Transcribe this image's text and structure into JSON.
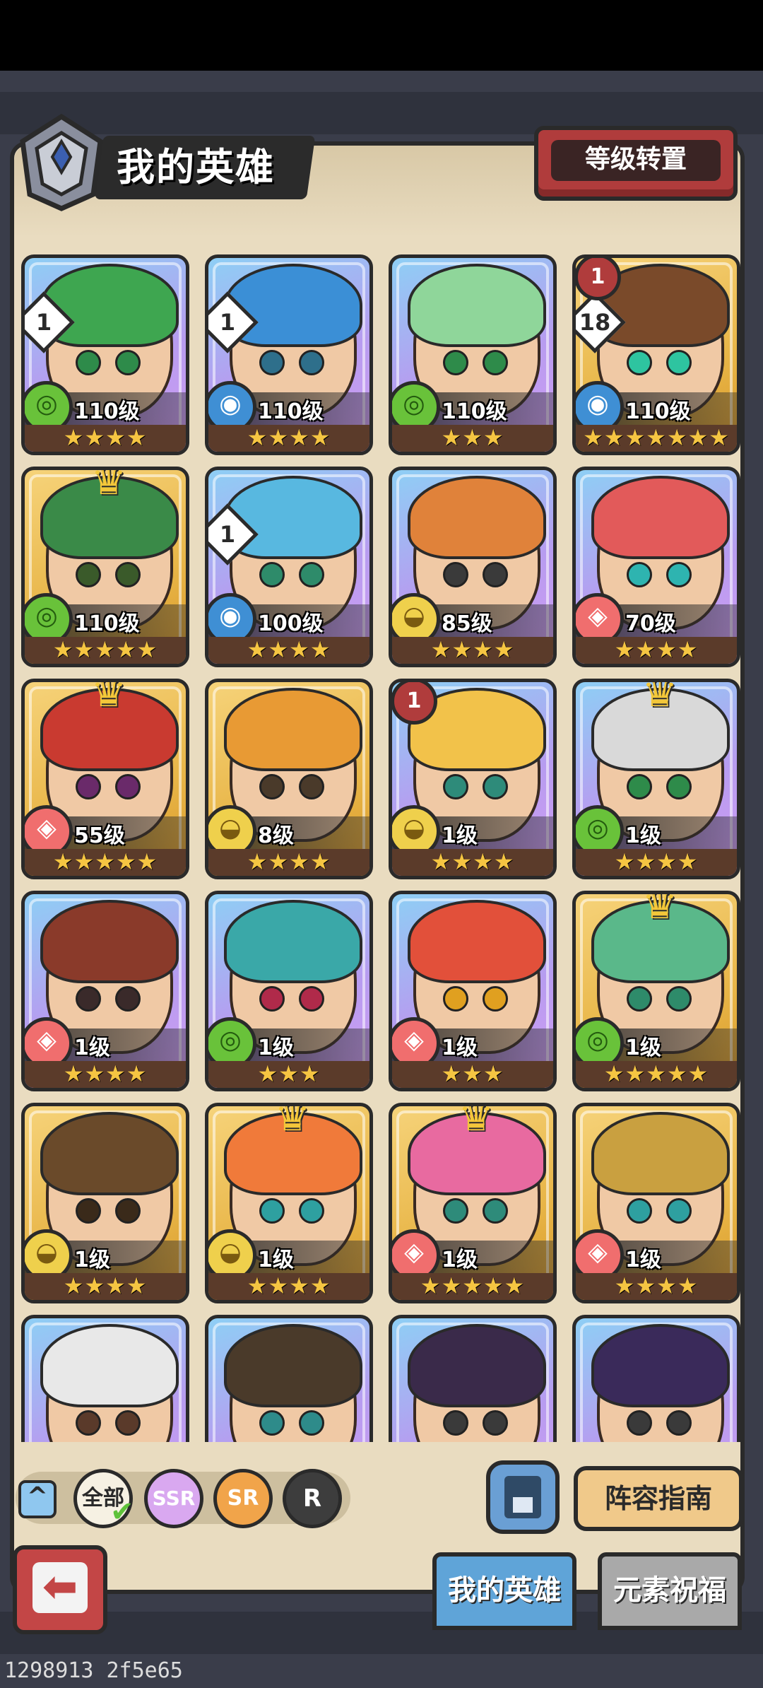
{
  "header": {
    "title": "我的英雄",
    "transfer_button": "等级转置"
  },
  "heroes": [
    {
      "rarity": "ssr",
      "element": "wind",
      "level": "110级",
      "stars": "★★★★",
      "badge": "1",
      "crown": false,
      "rank": "",
      "hair": "#3ea650",
      "eye": "#2e8b4a"
    },
    {
      "rarity": "ssr",
      "element": "water",
      "level": "110级",
      "stars": "★★★★",
      "badge": "1",
      "crown": false,
      "rank": "",
      "hair": "#3b8fd6",
      "eye": "#2e6f8b"
    },
    {
      "rarity": "ssr",
      "element": "wind",
      "level": "110级",
      "stars": "★★★",
      "badge": "",
      "crown": false,
      "rank": "",
      "hair": "#8fd69a",
      "eye": "#2e8b4a"
    },
    {
      "rarity": "sr",
      "element": "water",
      "level": "110级",
      "stars": "★★★★★★★",
      "badge": "18",
      "crown": false,
      "rank": "1",
      "hair": "#7a4a2a",
      "eye": "#2ec4a0"
    },
    {
      "rarity": "sr",
      "element": "wind",
      "level": "110级",
      "stars": "★★★★★",
      "badge": "",
      "crown": true,
      "rank": "",
      "hair": "#3a8a48",
      "eye": "#3a5a2a"
    },
    {
      "rarity": "ssr",
      "element": "water",
      "level": "100级",
      "stars": "★★★★",
      "badge": "1",
      "crown": false,
      "rank": "",
      "hair": "#58b8e0",
      "eye": "#2e8b6a"
    },
    {
      "rarity": "ssr",
      "element": "earth",
      "level": "85级",
      "stars": "★★★★",
      "badge": "",
      "crown": false,
      "rank": "",
      "hair": "#e0823a",
      "eye": "#3a3a3a"
    },
    {
      "rarity": "ssr",
      "element": "fire",
      "level": "70级",
      "stars": "★★★★",
      "badge": "",
      "crown": false,
      "rank": "",
      "hair": "#e25a5a",
      "eye": "#2eb4b0"
    },
    {
      "rarity": "sr",
      "element": "fire",
      "level": "55级",
      "stars": "★★★★★",
      "badge": "",
      "crown": true,
      "rank": "",
      "hair": "#c93a30",
      "eye": "#6a2a6a"
    },
    {
      "rarity": "sr",
      "element": "earth",
      "level": "8级",
      "stars": "★★★★",
      "badge": "",
      "crown": false,
      "rank": "",
      "hair": "#e89a34",
      "eye": "#4a3a2a"
    },
    {
      "rarity": "ssr",
      "element": "earth",
      "level": "1级",
      "stars": "★★★★",
      "badge": "",
      "crown": false,
      "rank": "1",
      "hair": "#f2c24a",
      "eye": "#2e8b7a"
    },
    {
      "rarity": "ssr",
      "element": "wind",
      "level": "1级",
      "stars": "★★★★",
      "badge": "",
      "crown": true,
      "rank": "",
      "hair": "#d9d9d9",
      "eye": "#2e8b4a"
    },
    {
      "rarity": "ssr",
      "element": "fire",
      "level": "1级",
      "stars": "★★★★",
      "badge": "",
      "crown": false,
      "rank": "",
      "hair": "#8a3a2a",
      "eye": "#3a2a2a"
    },
    {
      "rarity": "ssr",
      "element": "wind",
      "level": "1级",
      "stars": "★★★",
      "badge": "",
      "crown": false,
      "rank": "",
      "hair": "#3aa8a8",
      "eye": "#b02a4a"
    },
    {
      "rarity": "ssr",
      "element": "fire",
      "level": "1级",
      "stars": "★★★",
      "badge": "",
      "crown": false,
      "rank": "",
      "hair": "#e2503a",
      "eye": "#e0a020"
    },
    {
      "rarity": "sr",
      "element": "wind",
      "level": "1级",
      "stars": "★★★★★",
      "badge": "",
      "crown": true,
      "rank": "",
      "hair": "#5ab88a",
      "eye": "#2e8b6a"
    },
    {
      "rarity": "sr",
      "element": "earth",
      "level": "1级",
      "stars": "★★★★",
      "badge": "",
      "crown": false,
      "rank": "",
      "hair": "#6a4a2a",
      "eye": "#3a2a1a"
    },
    {
      "rarity": "sr",
      "element": "earth",
      "level": "1级",
      "stars": "★★★★",
      "badge": "",
      "crown": true,
      "rank": "",
      "hair": "#f07a3a",
      "eye": "#2ea0a0"
    },
    {
      "rarity": "sr",
      "element": "fire",
      "level": "1级",
      "stars": "★★★★★",
      "badge": "",
      "crown": true,
      "rank": "",
      "hair": "#e86aa0",
      "eye": "#2e8b7a"
    },
    {
      "rarity": "sr",
      "element": "fire",
      "level": "1级",
      "stars": "★★★★",
      "badge": "",
      "crown": false,
      "rank": "",
      "hair": "#c9a040",
      "eye": "#2ea0a0"
    },
    {
      "rarity": "ssr",
      "element": "water",
      "level": "",
      "stars": "",
      "badge": "",
      "crown": false,
      "rank": "",
      "hair": "#e8e8e8",
      "eye": "#5a3a2a"
    },
    {
      "rarity": "ssr",
      "element": "water",
      "level": "",
      "stars": "",
      "badge": "",
      "crown": false,
      "rank": "",
      "hair": "#4a3a2a",
      "eye": "#2e8b8a"
    },
    {
      "rarity": "ssr",
      "element": "wind",
      "level": "",
      "stars": "",
      "badge": "",
      "crown": false,
      "rank": "",
      "hair": "#3a2a4a",
      "eye": "#3a3a3a"
    },
    {
      "rarity": "ssr",
      "element": "water",
      "level": "",
      "stars": "",
      "badge": "",
      "crown": false,
      "rank": "",
      "hair": "#3a2a5a",
      "eye": "#3a3a3a"
    }
  ],
  "element_icons": {
    "wind": "◎",
    "water": "◉",
    "earth": "◒",
    "fire": "◈"
  },
  "filters": {
    "all": "全部",
    "ssr": "SSR",
    "sr": "SR",
    "r": "R",
    "collapse": "^"
  },
  "bottom": {
    "guide_button": "阵容指南",
    "tab_my_heroes": "我的英雄",
    "tab_blessing": "元素祝福",
    "back": "⬅"
  },
  "footer_code": "1298913 2f5e65"
}
